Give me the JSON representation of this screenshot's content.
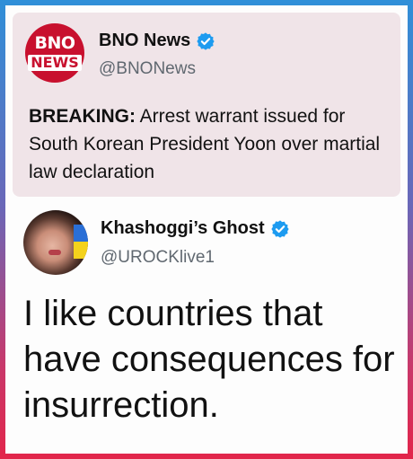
{
  "colors": {
    "frame_top": "#2f8fd8",
    "frame_bottom": "#e2254a",
    "tweet1_background": "#f0e4e8",
    "bno_red": "#c8102e",
    "verified_blue": "#1d9bf0"
  },
  "tweet1": {
    "avatar_logo_top": "BNO",
    "avatar_logo_bottom": "NEWS",
    "display_name": "BNO News",
    "handle": "@BNONews",
    "breaking_label": "BREAKING:",
    "text": " Arrest warrant issued for South Korean President Yoon over martial law declaration",
    "verified_icon": "verified-badge-icon"
  },
  "tweet2": {
    "display_name": "Khashoggi’s Ghost",
    "handle": "@UROCKlive1",
    "text": "I like countries that have consequences for insurrection.",
    "verified_icon": "verified-badge-icon"
  }
}
